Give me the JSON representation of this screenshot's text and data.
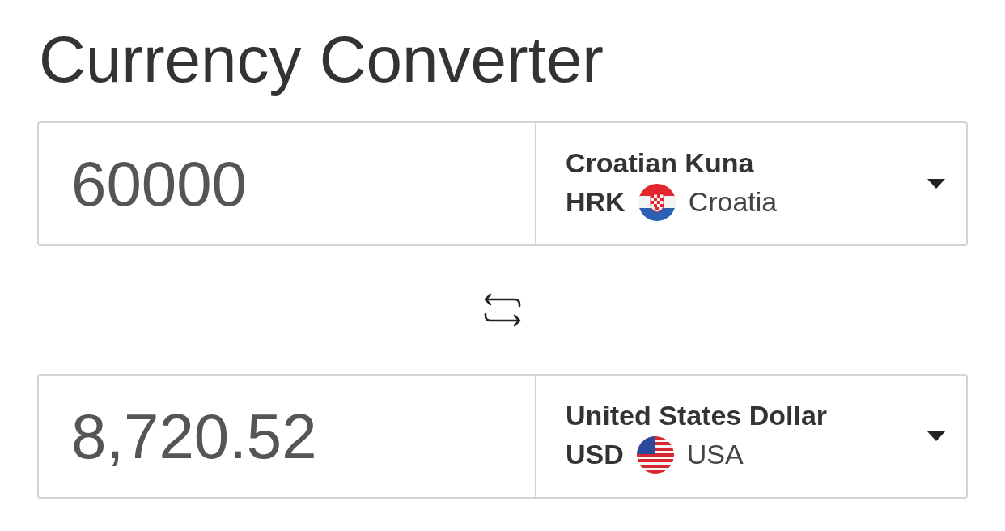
{
  "title": "Currency Converter",
  "converters": [
    {
      "amount": "60000",
      "currency_name": "Croatian Kuna",
      "code": "HRK",
      "country": "Croatia",
      "kind": "hr"
    },
    {
      "amount": "8,720.52",
      "currency_name": "United States Dollar",
      "code": "USD",
      "country": "USA",
      "kind": "us"
    }
  ]
}
